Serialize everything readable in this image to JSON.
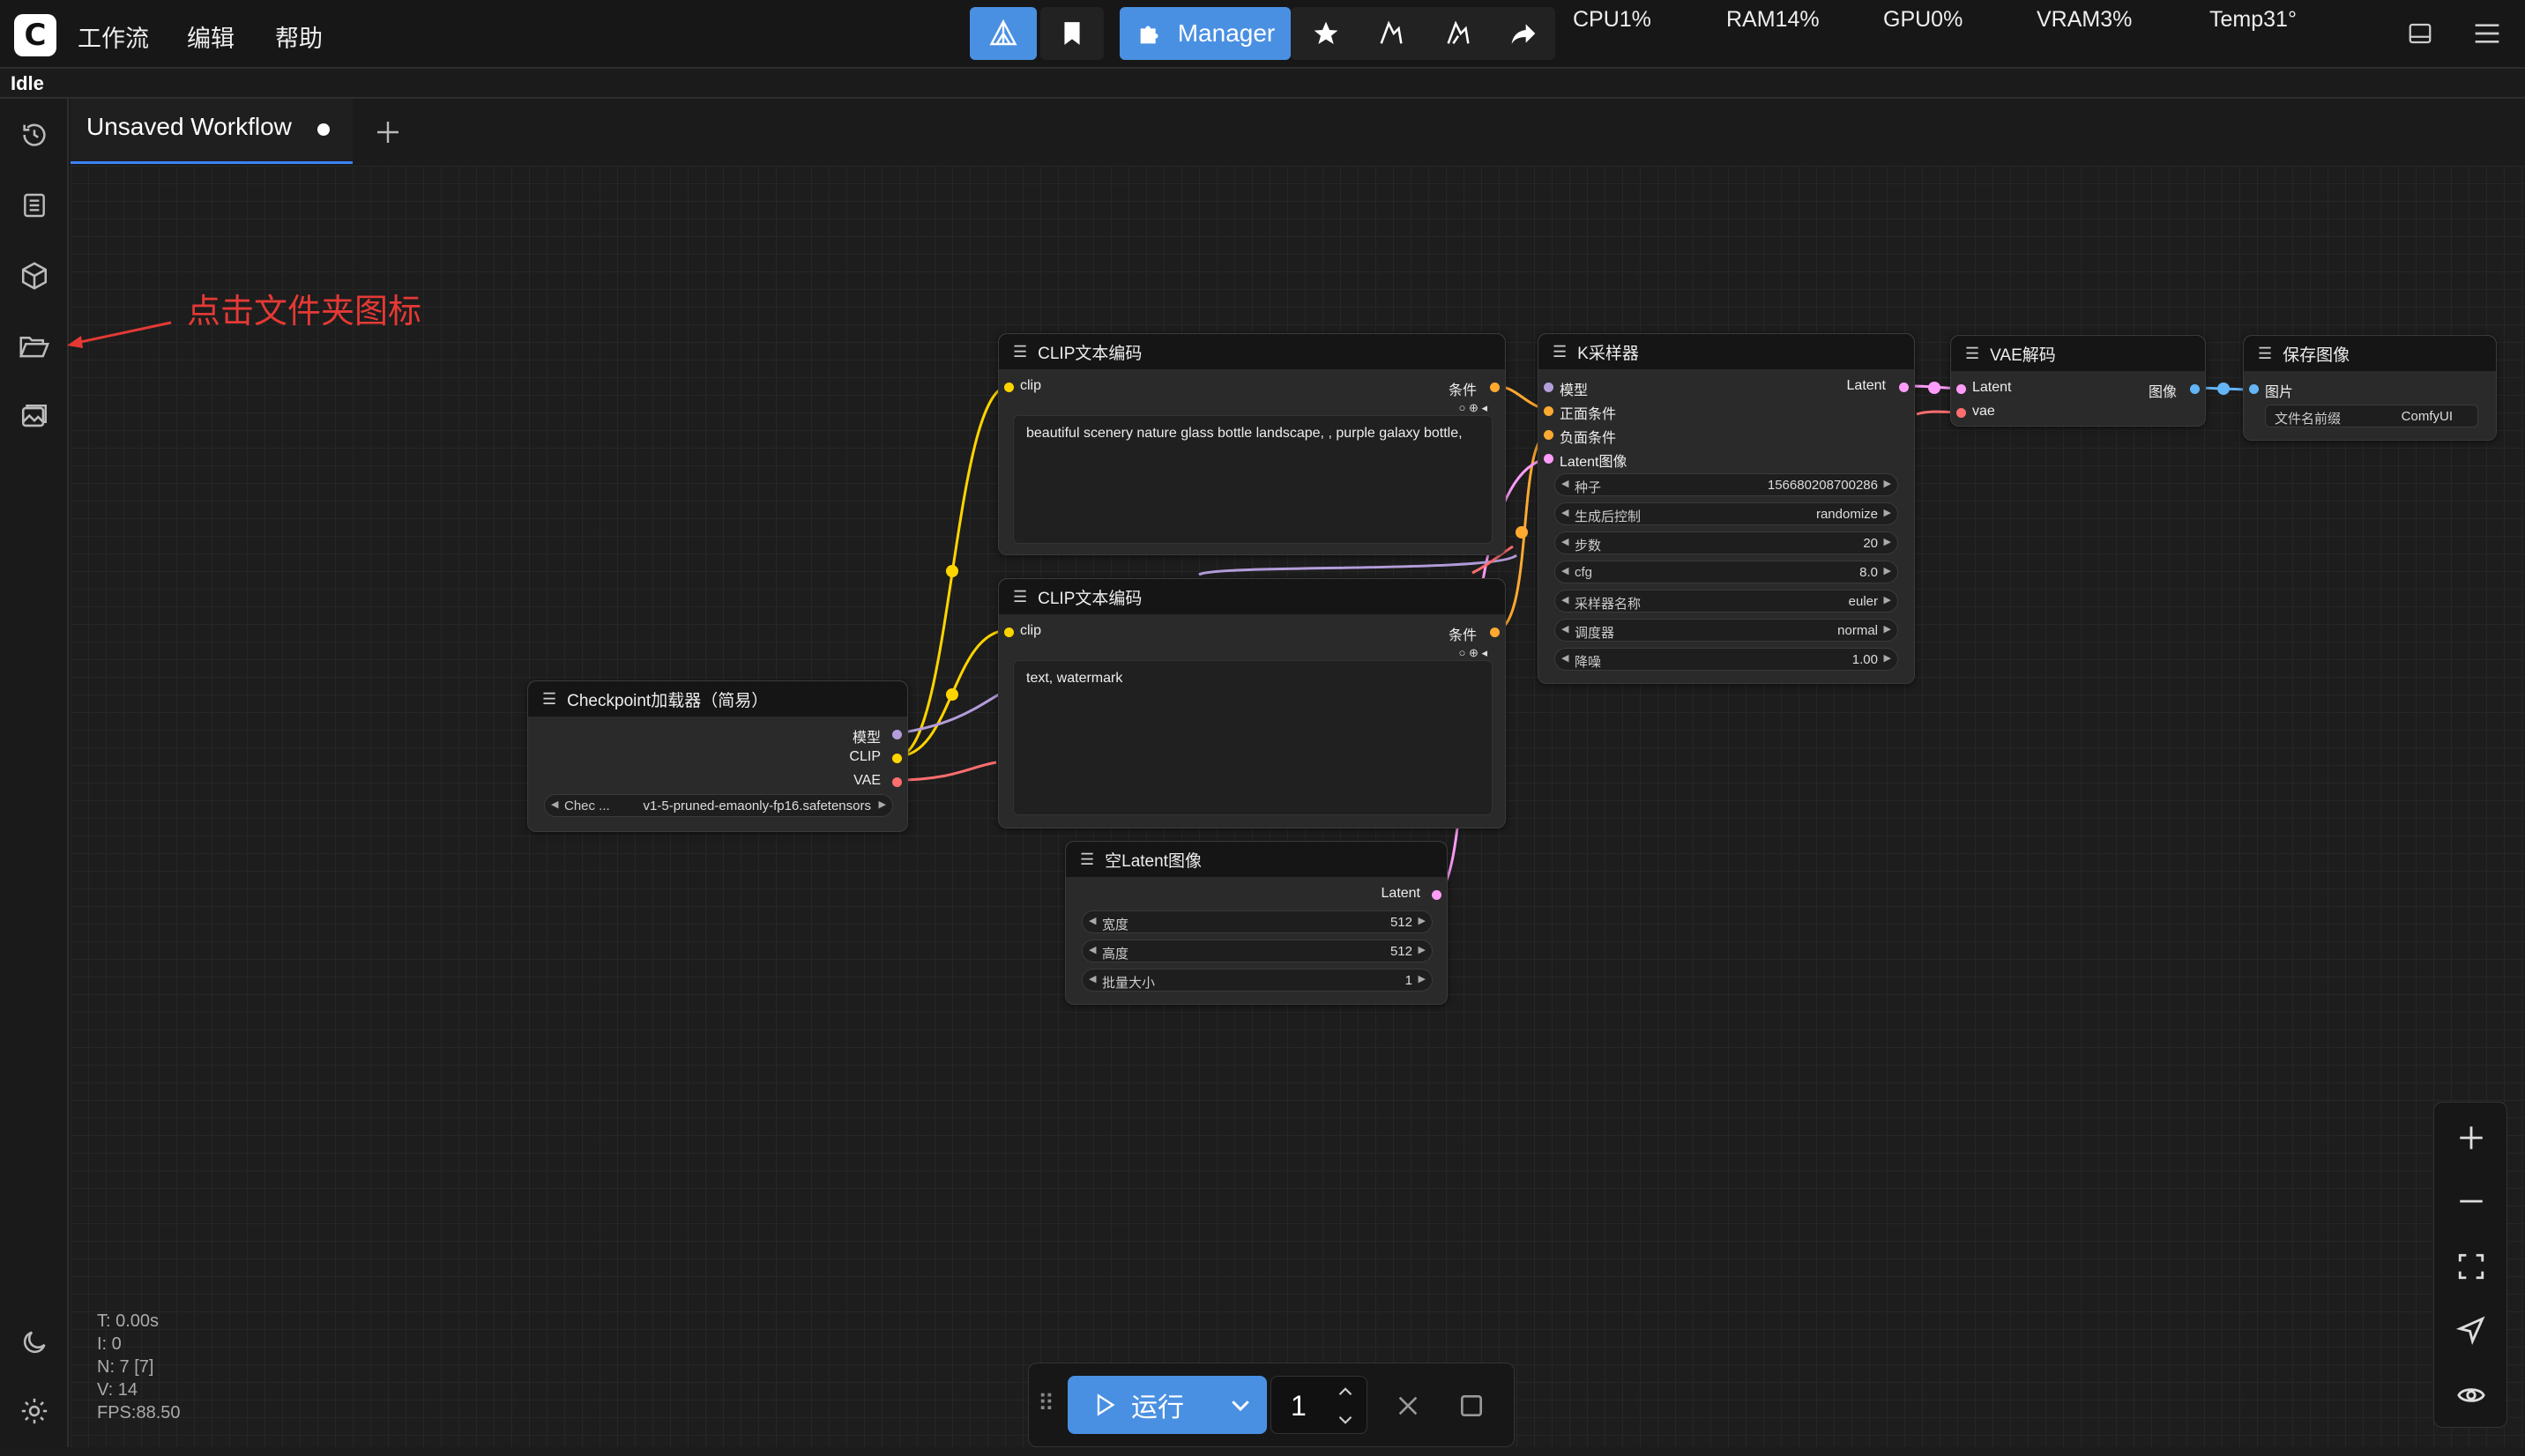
{
  "app": {
    "logo_letter": "C"
  },
  "menu": {
    "workflow": "工作流",
    "edit": "编辑",
    "help": "帮助"
  },
  "toolbar": {
    "manager_label": "Manager"
  },
  "system": {
    "cpu": "CPU1%",
    "ram": "RAM14%",
    "gpu": "GPU0%",
    "vram": "VRAM3%",
    "temp": "Temp31°"
  },
  "status": "Idle",
  "tab": {
    "title": "Unsaved Workflow"
  },
  "annotation": "点击文件夹图标",
  "nodes": {
    "clip_pos": {
      "title": "CLIP文本编码",
      "in_clip": "clip",
      "out": "条件",
      "text": "beautiful scenery nature glass bottle landscape, , purple galaxy bottle,"
    },
    "clip_neg": {
      "title": "CLIP文本编码",
      "in_clip": "clip",
      "out": "条件",
      "text": "text, watermark"
    },
    "ksampler": {
      "title": "K采样器",
      "inputs": [
        "模型",
        "正面条件",
        "负面条件",
        "Latent图像"
      ],
      "out": "Latent",
      "widgets": [
        {
          "label": "种子",
          "value": "156680208700286"
        },
        {
          "label": "生成后控制",
          "value": "randomize"
        },
        {
          "label": "步数",
          "value": "20"
        },
        {
          "label": "cfg",
          "value": "8.0"
        },
        {
          "label": "采样器名称",
          "value": "euler"
        },
        {
          "label": "调度器",
          "value": "normal"
        },
        {
          "label": "降噪",
          "value": "1.00"
        }
      ]
    },
    "vae_decode": {
      "title": "VAE解码",
      "in_latent": "Latent",
      "in_vae": "vae",
      "out": "图像"
    },
    "save_image": {
      "title": "保存图像",
      "in_image": "图片",
      "widget_label": "文件名前缀",
      "widget_value": "ComfyUI"
    },
    "checkpoint": {
      "title": "Checkpoint加载器（简易）",
      "out_model": "模型",
      "out_clip": "CLIP",
      "out_vae": "VAE",
      "widget_label": "Chec ...",
      "widget_value": "v1-5-pruned-emaonly-fp16.safetensors"
    },
    "empty_latent": {
      "title": "空Latent图像",
      "out": "Latent",
      "widgets": [
        {
          "label": "宽度",
          "value": "512"
        },
        {
          "label": "高度",
          "value": "512"
        },
        {
          "label": "批量大小",
          "value": "1"
        }
      ]
    }
  },
  "run": {
    "label": "运行",
    "count": "1"
  },
  "stats": {
    "t": "T: 0.00s",
    "i": "I: 0",
    "n": "N: 7 [7]",
    "v": "V: 14",
    "fps": "FPS:88.50"
  },
  "colors": {
    "accent": "#4a90e2",
    "clip": "#ffd500",
    "model": "#b39ddb",
    "vae": "#ff6e6e",
    "latent": "#ff9cf9",
    "cond": "#ffa931",
    "image": "#64b5f6",
    "annotation": "#e53935"
  }
}
